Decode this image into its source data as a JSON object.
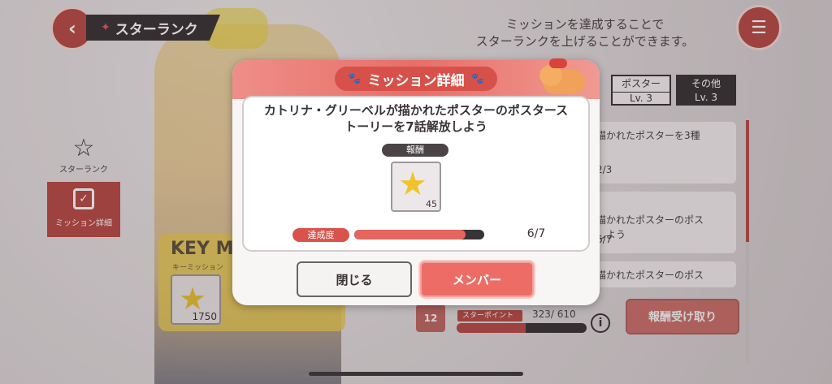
{
  "header": {
    "title": "スターランク",
    "back_icon": "back-arrow-icon",
    "menu_icon": "list-menu-icon",
    "description": "ミッションを達成することで\nスターランクを上げることができます。"
  },
  "side_nav": {
    "items": [
      {
        "label": "スターランク",
        "icon": "star-icon"
      },
      {
        "label": "ミッション詳細",
        "icon": "checkbox-icon"
      }
    ]
  },
  "key_mission": {
    "title": "KEY M",
    "subtitle": "キーミッション",
    "reward_count": "1750"
  },
  "tabs": [
    {
      "label": "ポスター",
      "level": "Lv. 3"
    },
    {
      "label": "その他",
      "level": "Lv. 3"
    }
  ],
  "mission_list": [
    {
      "text": "描かれたポスターを3種",
      "progress": "2/3"
    },
    {
      "text": "描かれたポスターのポス\nしよう",
      "progress": "6/7"
    },
    {
      "text": "描かれたポスターのポス",
      "progress": ""
    }
  ],
  "star_points": {
    "label": "スターポイント",
    "value": "323/ 610",
    "current": 323,
    "max": 610
  },
  "rank_badge": "12",
  "claim_button": "報酬受け取り",
  "modal": {
    "title": "ミッション詳細",
    "mission_text": "カトリナ・グリーベルが描かれたポスターのポスターストーリーを7話解放しよう",
    "reward_label": "報酬",
    "reward_count": "45",
    "progress_label": "達成度",
    "progress_current": 6,
    "progress_max": 7,
    "progress_text": "6/7",
    "close_button": "閉じる",
    "member_button": "メンバー"
  }
}
